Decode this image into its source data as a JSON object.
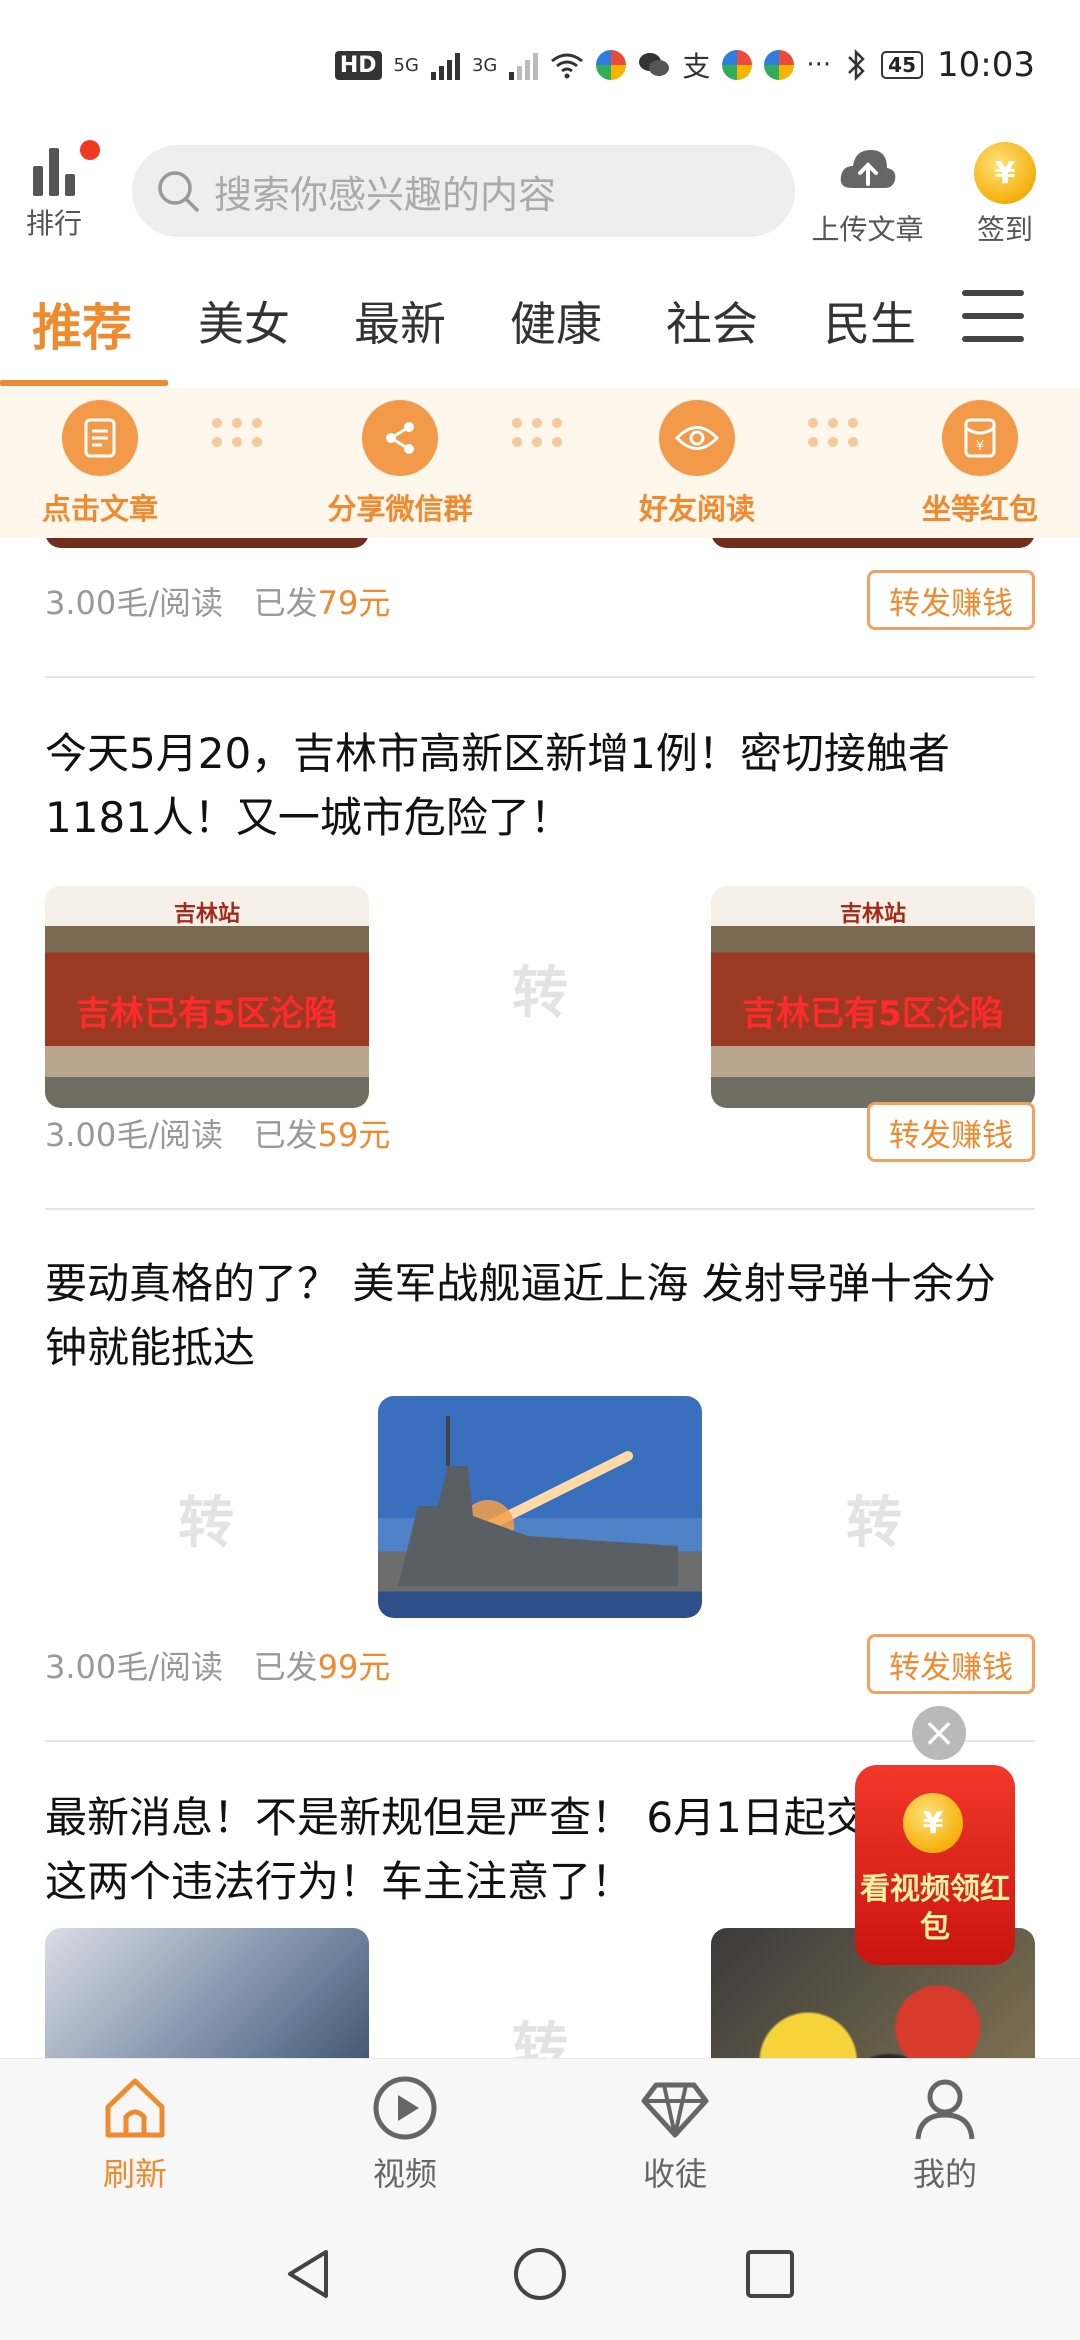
{
  "status_bar": {
    "network_label": "HD",
    "gen_5g": "5G",
    "gen_3g": "3G",
    "battery": "45",
    "time": "10:03",
    "app_glyph": "支",
    "more": "···"
  },
  "header": {
    "rank_label": "排行",
    "search_placeholder": "搜索你感兴趣的内容",
    "upload_label": "上传文章",
    "signin_label": "签到",
    "coin_symbol": "¥"
  },
  "tabs": [
    "推荐",
    "美女",
    "最新",
    "健康",
    "社会",
    "民生"
  ],
  "steps": [
    "点击文章",
    "分享微信群",
    "好友阅读",
    "坐等红包"
  ],
  "feed": {
    "watermark": "转",
    "earn_label": "转发赚钱",
    "articles": [
      {
        "rate": "3.00毛/阅读",
        "sent_prefix": "已发",
        "sent_amount": "79元"
      },
      {
        "title": "今天5月20，吉林市高新区新增1例！密切接触者1181人！又一城市危险了！",
        "image_sign": "吉林站",
        "image_overlay": "吉林已有5区沦陷",
        "rate": "3.00毛/阅读",
        "sent_prefix": "已发",
        "sent_amount": "59元"
      },
      {
        "title": "要动真格的了？ 美军战舰逼近上海 发射导弹十余分钟就能抵达",
        "rate": "3.00毛/阅读",
        "sent_prefix": "已发",
        "sent_amount": "99元"
      },
      {
        "title": "最新消息！不是新规但是严查！ 6月1日起交警就抓这两个违法行为！车主注意了！"
      }
    ]
  },
  "floating_packet": {
    "text": "看视频领红包",
    "close": "×"
  },
  "bottom_nav": [
    "刷新",
    "视频",
    "收徒",
    "我的"
  ],
  "colors": {
    "accent": "#f08a2e",
    "step_bg": "#fff6ec",
    "red_packet": "#e3241b"
  }
}
